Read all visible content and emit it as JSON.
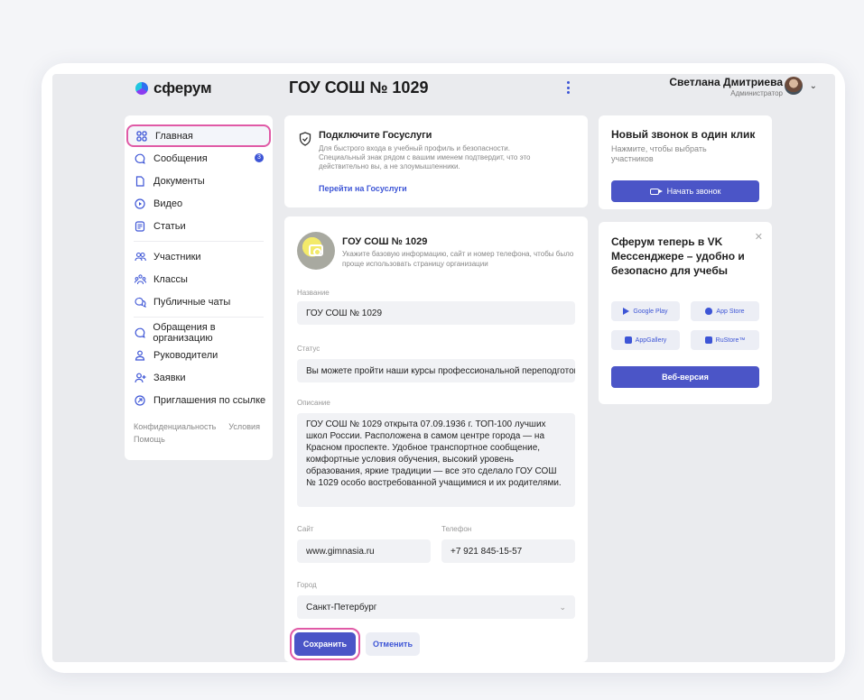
{
  "header": {
    "logo_text": "сферум",
    "org_title": "ГОУ СОШ № 1029",
    "user_name": "Светлана Дмитриева",
    "user_role": "Администратор"
  },
  "sidebar": {
    "items": [
      {
        "label": "Главная",
        "icon": "grid-icon"
      },
      {
        "label": "Сообщения",
        "icon": "chat-icon",
        "badge": "3"
      },
      {
        "label": "Документы",
        "icon": "document-icon"
      },
      {
        "label": "Видео",
        "icon": "video-icon"
      },
      {
        "label": "Статьи",
        "icon": "article-icon"
      },
      {
        "label": "Участники",
        "icon": "people-icon"
      },
      {
        "label": "Классы",
        "icon": "classes-icon"
      },
      {
        "label": "Публичные чаты",
        "icon": "public-chat-icon"
      },
      {
        "label": "Обращения в организацию",
        "icon": "appeal-icon"
      },
      {
        "label": "Руководители",
        "icon": "person-icon"
      },
      {
        "label": "Заявки",
        "icon": "person-add-icon"
      },
      {
        "label": "Приглашения по ссылке",
        "icon": "link-icon"
      }
    ],
    "footer": {
      "privacy": "Конфиденциальность",
      "terms": "Условия",
      "help": "Помощь"
    }
  },
  "gosuslugi": {
    "title": "Подключите Госуслуги",
    "text": "Для быстрого входа в учебный профиль и безопасности. Специальный знак рядом с вашим именем подтвердит, что это действительно вы, а не злоумышленники.",
    "link": "Перейти на Госуслуги"
  },
  "profile": {
    "title": "ГОУ СОШ № 1029",
    "subtitle": "Укажите базовую информацию, сайт и номер телефона, чтобы было проще использовать страницу организации",
    "name_label": "Название",
    "name_value": "ГОУ СОШ № 1029",
    "status_label": "Статус",
    "status_value": "Вы можете пройти наши курсы профессиональной переподготовк",
    "description_label": "Описание",
    "description_value": "ГОУ СОШ № 1029 открыта 07.09.1936 г. ТОП-100 лучших школ России. Расположена в самом центре города — на Красном проспекте. Удобное транспортное сообщение, комфортные условия обучения, высокий уровень образования, яркие традиции — все это сделало ГОУ СОШ № 1029 особо востребованной учащимися и их родителями.",
    "site_label": "Сайт",
    "site_value": "www.gimnasia.ru",
    "phone_label": "Телефон",
    "phone_value": "+7 921 845-15-57",
    "city_label": "Город",
    "city_value": "Санкт-Петербург",
    "save_label": "Сохранить",
    "cancel_label": "Отменить"
  },
  "call": {
    "title": "Новый звонок в один клик",
    "subtitle": "Нажмите, чтобы выбрать участников",
    "button": "Начать звонок"
  },
  "vk": {
    "title": "Сферум теперь в VK Мессенджере – удобно и безопасно для учебы",
    "google_play": "Google Play",
    "app_store": "App Store",
    "app_gallery": "AppGallery",
    "rustore": "RuStore™",
    "web_button": "Веб-версия"
  },
  "colors": {
    "accent": "#4b55c7",
    "highlight": "#e05aa6",
    "link": "#3d55d6"
  }
}
